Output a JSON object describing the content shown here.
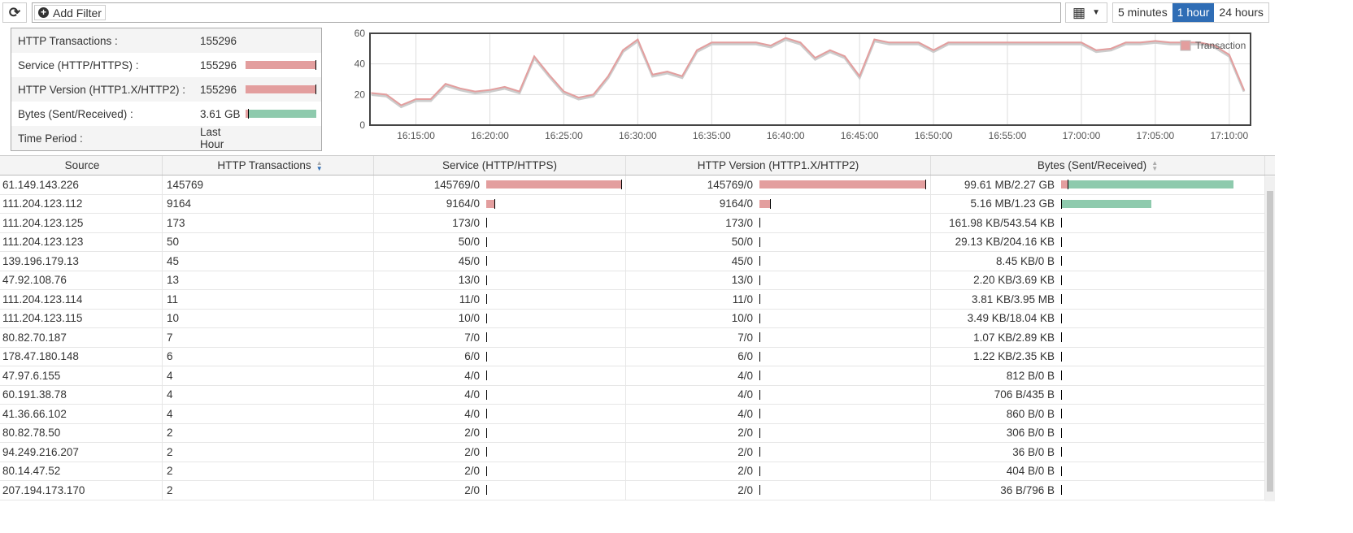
{
  "toolbar": {
    "add_filter": "Add Filter",
    "time_options": [
      "5 minutes",
      "1 hour",
      "24 hours"
    ],
    "active_time": "1 hour"
  },
  "summary": [
    {
      "label": "HTTP Transactions :",
      "value": "155296"
    },
    {
      "label": "Service (HTTP/HTTPS) :",
      "value": "155296",
      "bar": [
        1,
        0
      ]
    },
    {
      "label": "HTTP Version (HTTP1.X/HTTP2) :",
      "value": "155296",
      "bar": [
        1,
        0
      ]
    },
    {
      "label": "Bytes (Sent/Received) :",
      "value": "3.61 GB",
      "bar": [
        0.04,
        0.96
      ]
    },
    {
      "label": "Time Period :",
      "value": "Last Hour"
    }
  ],
  "colors": {
    "red": "#e39e9e",
    "green": "#8ecaad",
    "accent": "#2f6db5"
  },
  "chart_data": {
    "type": "line",
    "legend": "Transaction",
    "legend_position": "top-right",
    "grid": true,
    "ylim": [
      0,
      60
    ],
    "yticks": [
      0,
      20,
      40,
      60
    ],
    "xticks": [
      "16:15:00",
      "16:20:00",
      "16:25:00",
      "16:30:00",
      "16:35:00",
      "16:40:00",
      "16:45:00",
      "16:50:00",
      "16:55:00",
      "17:00:00",
      "17:05:00",
      "17:10:00"
    ],
    "x_start": "16:12",
    "x_step_minutes": 1,
    "values": [
      21,
      20,
      13,
      17,
      17,
      27,
      24,
      22,
      23,
      25,
      22,
      45,
      33,
      22,
      18,
      20,
      32,
      49,
      56,
      33,
      35,
      32,
      49,
      54,
      54,
      54,
      54,
      52,
      57,
      54,
      44,
      49,
      45,
      32,
      56,
      54,
      54,
      54,
      49,
      54,
      54,
      54,
      54,
      54,
      54,
      54,
      54,
      54,
      54,
      49,
      50,
      54,
      54,
      55,
      54,
      54,
      54,
      52,
      46,
      23
    ]
  },
  "table": {
    "headers": [
      "Source",
      "HTTP Transactions",
      "Service (HTTP/HTTPS)",
      "HTTP Version (HTTP1.X/HTTP2)",
      "Bytes (Sent/Received)"
    ],
    "rows": [
      {
        "source": "61.149.143.226",
        "tx": "145769",
        "service": "145769/0",
        "version": "145769/0",
        "bytes": "99.61 MB/2.27 GB",
        "bytes_bar": [
          0.04,
          0.96
        ]
      },
      {
        "source": "111.204.123.112",
        "tx": "9164",
        "service": "9164/0",
        "version": "9164/0",
        "bytes": "5.16 MB/1.23 GB",
        "bytes_bar": [
          0.002,
          0.52
        ]
      },
      {
        "source": "111.204.123.125",
        "tx": "173",
        "service": "173/0",
        "version": "173/0",
        "bytes": "161.98 KB/543.54 KB",
        "bytes_bar": [
          0,
          0
        ]
      },
      {
        "source": "111.204.123.123",
        "tx": "50",
        "service": "50/0",
        "version": "50/0",
        "bytes": "29.13 KB/204.16 KB",
        "bytes_bar": [
          0,
          0
        ]
      },
      {
        "source": "139.196.179.13",
        "tx": "45",
        "service": "45/0",
        "version": "45/0",
        "bytes": "8.45 KB/0 B",
        "bytes_bar": [
          0,
          0
        ]
      },
      {
        "source": "47.92.108.76",
        "tx": "13",
        "service": "13/0",
        "version": "13/0",
        "bytes": "2.20 KB/3.69 KB",
        "bytes_bar": [
          0,
          0
        ]
      },
      {
        "source": "111.204.123.114",
        "tx": "11",
        "service": "11/0",
        "version": "11/0",
        "bytes": "3.81 KB/3.95 MB",
        "bytes_bar": [
          0,
          0
        ]
      },
      {
        "source": "111.204.123.115",
        "tx": "10",
        "service": "10/0",
        "version": "10/0",
        "bytes": "3.49 KB/18.04 KB",
        "bytes_bar": [
          0,
          0
        ]
      },
      {
        "source": "80.82.70.187",
        "tx": "7",
        "service": "7/0",
        "version": "7/0",
        "bytes": "1.07 KB/2.89 KB",
        "bytes_bar": [
          0,
          0
        ]
      },
      {
        "source": "178.47.180.148",
        "tx": "6",
        "service": "6/0",
        "version": "6/0",
        "bytes": "1.22 KB/2.35 KB",
        "bytes_bar": [
          0,
          0
        ]
      },
      {
        "source": "47.97.6.155",
        "tx": "4",
        "service": "4/0",
        "version": "4/0",
        "bytes": "812 B/0 B",
        "bytes_bar": [
          0,
          0
        ]
      },
      {
        "source": "60.191.38.78",
        "tx": "4",
        "service": "4/0",
        "version": "4/0",
        "bytes": "706 B/435 B",
        "bytes_bar": [
          0,
          0
        ]
      },
      {
        "source": "41.36.66.102",
        "tx": "4",
        "service": "4/0",
        "version": "4/0",
        "bytes": "860 B/0 B",
        "bytes_bar": [
          0,
          0
        ]
      },
      {
        "source": "80.82.78.50",
        "tx": "2",
        "service": "2/0",
        "version": "2/0",
        "bytes": "306 B/0 B",
        "bytes_bar": [
          0,
          0
        ]
      },
      {
        "source": "94.249.216.207",
        "tx": "2",
        "service": "2/0",
        "version": "2/0",
        "bytes": "36 B/0 B",
        "bytes_bar": [
          0,
          0
        ]
      },
      {
        "source": "80.14.47.52",
        "tx": "2",
        "service": "2/0",
        "version": "2/0",
        "bytes": "404 B/0 B",
        "bytes_bar": [
          0,
          0
        ]
      },
      {
        "source": "207.194.173.170",
        "tx": "2",
        "service": "2/0",
        "version": "2/0",
        "bytes": "36 B/796 B",
        "bytes_bar": [
          0,
          0
        ]
      }
    ]
  }
}
